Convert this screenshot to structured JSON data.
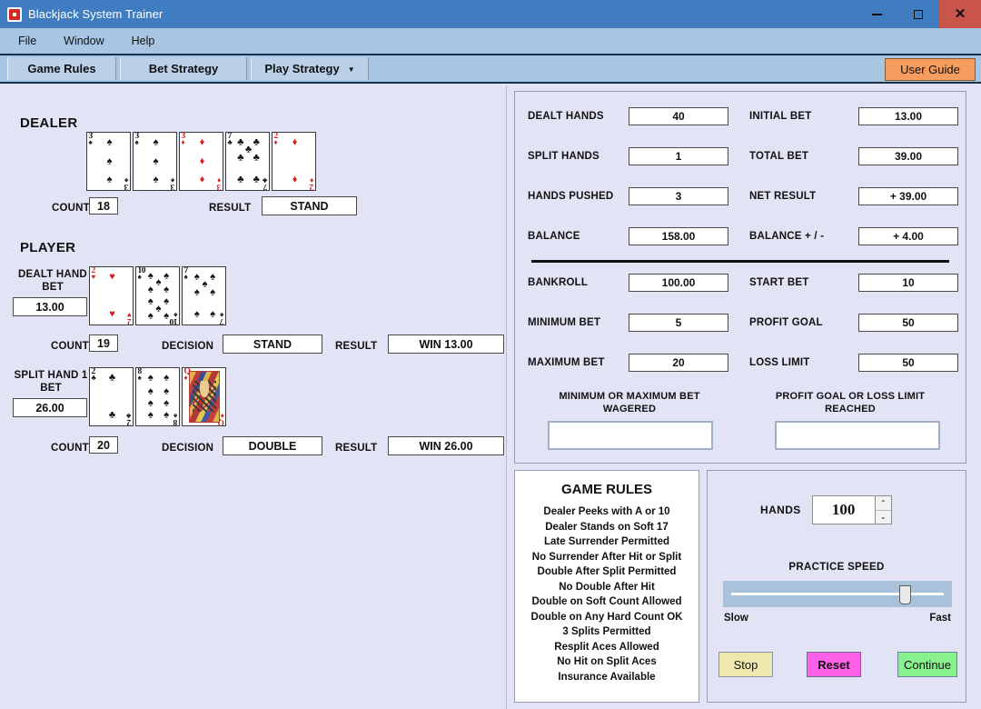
{
  "window": {
    "title": "Blackjack System Trainer",
    "icon": "app-gear-icon",
    "minimize": "–",
    "maximize": "□",
    "close": "✕"
  },
  "menubar": {
    "items": [
      "File",
      "Window",
      "Help"
    ]
  },
  "toolbar": {
    "tabs": [
      {
        "label": "Game Rules",
        "has_caret": false
      },
      {
        "label": "Bet Strategy",
        "has_caret": false
      },
      {
        "label": "Play Strategy",
        "has_caret": true,
        "caret": "▼"
      }
    ],
    "user_guide": "User Guide",
    "user_guide_color": "#f59c5f"
  },
  "dealer": {
    "title": "DEALER",
    "count_label": "COUNT",
    "count_value": "18",
    "result_label": "RESULT",
    "result_value": "STAND",
    "cards": [
      {
        "rank": "3",
        "suit": "♠",
        "color": "black",
        "pips": 3
      },
      {
        "rank": "3",
        "suit": "♠",
        "color": "black",
        "pips": 3
      },
      {
        "rank": "3",
        "suit": "♦",
        "color": "red",
        "pips": 3
      },
      {
        "rank": "7",
        "suit": "♣",
        "color": "black",
        "pips": 7
      },
      {
        "rank": "2",
        "suit": "♦",
        "color": "red",
        "pips": 2
      }
    ]
  },
  "player": {
    "title": "PLAYER",
    "hands": [
      {
        "name_line1": "DEALT HAND",
        "name_line2": "BET",
        "bet": "13.00",
        "count_label": "COUNT",
        "count_value": "19",
        "decision_label": "DECISION",
        "decision_value": "STAND",
        "result_label": "RESULT",
        "result_value": "WIN   13.00",
        "cards": [
          {
            "rank": "2",
            "suit": "♥",
            "color": "red",
            "pips": 2
          },
          {
            "rank": "10",
            "suit": "♠",
            "color": "black",
            "pips": 10
          },
          {
            "rank": "7",
            "suit": "♠",
            "color": "black",
            "pips": 7
          }
        ]
      },
      {
        "name_line1": "SPLIT HAND 1",
        "name_line2": "BET",
        "bet": "26.00",
        "count_label": "COUNT",
        "count_value": "20",
        "decision_label": "DECISION",
        "decision_value": "DOUBLE",
        "result_label": "RESULT",
        "result_value": "WIN   26.00",
        "cards": [
          {
            "rank": "2",
            "suit": "♣",
            "color": "black",
            "pips": 2
          },
          {
            "rank": "8",
            "suit": "♠",
            "color": "black",
            "pips": 8
          },
          {
            "rank": "Q",
            "suit": "♦",
            "color": "red",
            "pips": 0,
            "face": true
          }
        ]
      }
    ]
  },
  "stats": {
    "left_column": [
      {
        "label": "DEALT HANDS",
        "value": "40"
      },
      {
        "label": "SPLIT HANDS",
        "value": "1"
      },
      {
        "label": "HANDS PUSHED",
        "value": "3"
      },
      {
        "label": "BALANCE",
        "value": "158.00"
      }
    ],
    "right_column": [
      {
        "label": "INITIAL BET",
        "value": "13.00"
      },
      {
        "label": "TOTAL BET",
        "value": "39.00"
      },
      {
        "label": "NET RESULT",
        "value": "+ 39.00"
      },
      {
        "label": "BALANCE  + / -",
        "value": "+ 4.00"
      }
    ],
    "settings_left": [
      {
        "label": "BANKROLL",
        "value": "100.00"
      },
      {
        "label": "MINIMUM BET",
        "value": "5"
      },
      {
        "label": "MAXIMUM BET",
        "value": "20"
      }
    ],
    "settings_right": [
      {
        "label": "START BET",
        "value": "10"
      },
      {
        "label": "PROFIT GOAL",
        "value": "50"
      },
      {
        "label": "LOSS LIMIT",
        "value": "50"
      }
    ],
    "alert_left_caption_line1": "MINIMUM  OR  MAXIMUM  BET",
    "alert_left_caption_line2": "WAGERED",
    "alert_left_value": "",
    "alert_right_caption_line1": "PROFIT GOAL OR LOSS LIMIT",
    "alert_right_caption_line2": "REACHED",
    "alert_right_value": ""
  },
  "game_rules": {
    "title": "GAME RULES",
    "items": [
      "Dealer Peeks with A or 10",
      "Dealer Stands on Soft 17",
      "Late Surrender Permitted",
      "No Surrender After Hit or Split",
      "Double After Split Permitted",
      "No Double After Hit",
      "Double on Soft Count Allowed",
      "Double on Any Hard Count OK",
      "3 Splits Permitted",
      "Resplit Aces Allowed",
      "No Hit on Split Aces",
      "Insurance Available"
    ]
  },
  "controls": {
    "hands_label": "HANDS",
    "hands_value": "100",
    "spin_up": "⌃",
    "spin_down": "⌄",
    "speed_label": "PRACTICE SPEED",
    "speed_min_label": "Slow",
    "speed_max_label": "Fast",
    "speed_percent": 82,
    "buttons": [
      {
        "label": "Stop",
        "color": "#eee8ae"
      },
      {
        "label": "Reset",
        "color": "#ff60e8"
      },
      {
        "label": "Continue",
        "color": "#88f08d"
      }
    ]
  }
}
